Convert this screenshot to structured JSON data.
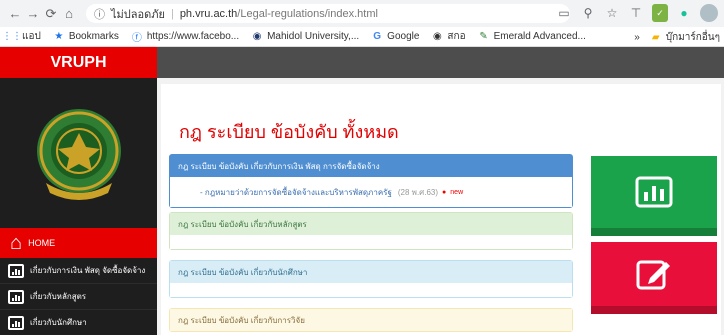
{
  "browser": {
    "security_label": "ไม่ปลอดภัย",
    "url_domain": "ph.vru.ac.th",
    "url_path": "/Legal-regulations/index.html"
  },
  "bookmarks": {
    "apps_label": "แอป",
    "items": [
      "Bookmarks",
      "https://www.facebo...",
      "Mahidol University,...",
      "Google",
      "สกอ",
      "Emerald Advanced..."
    ],
    "more_label": "»",
    "other_label": "บุ๊กมาร์กอื่นๆ"
  },
  "sidebar": {
    "brand": "VRUPH",
    "home_label": "HOME",
    "menu": [
      "เกี่ยวกับการเงิน พัสดุ จัดซื้อจัดจ้าง",
      "เกี่ยวกับหลักสูตร",
      "เกี่ยวกับนักศึกษา"
    ]
  },
  "main": {
    "title": "กฎ ระเบียบ ข้อบังคับ ทั้งหมด",
    "panels": [
      {
        "header": "กฎ ระเบียบ ข้อบังคับ เกี่ยวกับการเงิน พัสดุ การจัดซื้อจัดจ้าง",
        "item": "- กฎหมายว่าด้วยการจัดซื้อจัดจ้างและบริหารพัสดุภาครัฐ",
        "date": "(28 พ.ศ.63)",
        "badge": "new"
      },
      {
        "header": "กฎ ระเบียบ ข้อบังคับ เกี่ยวกับหลักสูตร"
      },
      {
        "header": "กฎ ระเบียบ ข้อบังคับ เกี่ยวกับนักศึกษา"
      },
      {
        "header": "กฎ ระเบียบ ข้อบังคับ เกี่ยวกับการวิจัย"
      }
    ]
  },
  "colors": {
    "brand_red": "#e60000",
    "tile_green": "#1aa34a",
    "tile_red": "#e8103a",
    "panel_blue": "#4e8ed1"
  }
}
